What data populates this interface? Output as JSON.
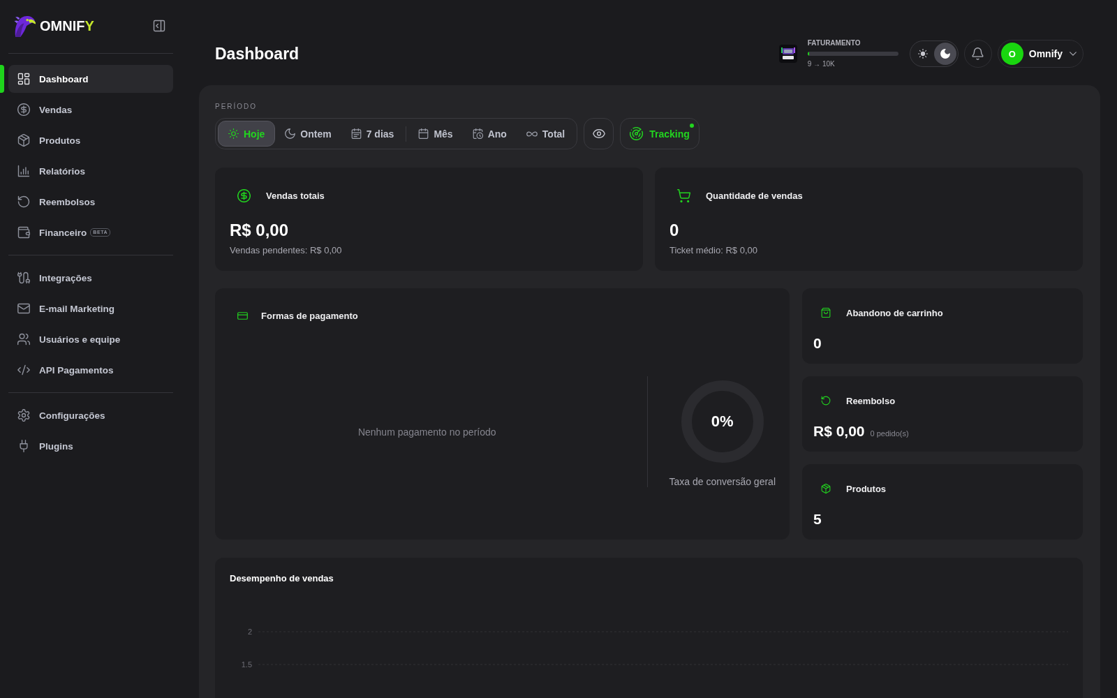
{
  "sidebar": {
    "logo": {
      "text": "OMNIF",
      "accent": "Y"
    },
    "nav_groups": [
      {
        "items": [
          {
            "label": "Dashboard",
            "selected": true
          },
          {
            "label": "Vendas",
            "selected": false
          },
          {
            "label": "Produtos",
            "selected": false
          },
          {
            "label": "Relatórios",
            "selected": false
          },
          {
            "label": "Reembolsos",
            "selected": false
          },
          {
            "label": "Financeiro",
            "badge": "BETA",
            "selected": false
          }
        ]
      },
      {
        "items": [
          {
            "label": "Integrações",
            "selected": false
          },
          {
            "label": "E-mail Marketing",
            "selected": false
          },
          {
            "label": "Usuários e equipe",
            "selected": false
          },
          {
            "label": "API Pagamentos",
            "selected": false
          }
        ]
      },
      {
        "items": [
          {
            "label": "Configurações",
            "selected": false
          },
          {
            "label": "Plugins",
            "selected": false
          }
        ]
      }
    ]
  },
  "header": {
    "title": "Dashboard",
    "goal": {
      "label": "FATURAMENTO",
      "level": 0.015,
      "reading": "9 → 10K"
    },
    "theme_toggle": [
      {
        "selected": false
      },
      {
        "selected": true
      }
    ],
    "user": {
      "initial": "O",
      "name": "Omnify"
    }
  },
  "period": {
    "label": "PERÍODO",
    "groups": [
      {
        "options": [
          {
            "label": "Hoje",
            "selected": true
          },
          {
            "label": "Ontem",
            "selected": false
          },
          {
            "label": "7 dias",
            "selected": false
          }
        ]
      },
      {
        "options": [
          {
            "label": "Mês",
            "selected": false
          },
          {
            "label": "Ano",
            "selected": false
          },
          {
            "label": "Total",
            "selected": false
          }
        ]
      }
    ],
    "tracking": {
      "label": "Tracking",
      "active": true
    }
  },
  "stat_cards": [
    {
      "title": "Vendas totais",
      "value": "R$ 0,00",
      "note": "Vendas pendentes: R$ 0,00"
    },
    {
      "title": "Quantidade de vendas",
      "value": "0",
      "note": "Ticket médio: R$ 0,00"
    }
  ],
  "payments": {
    "title": "Formas de pagamento",
    "empty_message": "Nenhum pagamento no período",
    "conversion": {
      "value": "0%",
      "label": "Taxa de conversão geral"
    }
  },
  "side_cards": [
    {
      "title": "Abandono de carrinho",
      "value": "0"
    },
    {
      "title": "Reembolso",
      "value": "R$ 0,00",
      "note": "0 pedido(s)"
    },
    {
      "title": "Produtos",
      "value": "5"
    }
  ],
  "performance": {
    "title": "Desempenho de vendas",
    "axis_labels": [
      "2",
      "1.5"
    ]
  }
}
